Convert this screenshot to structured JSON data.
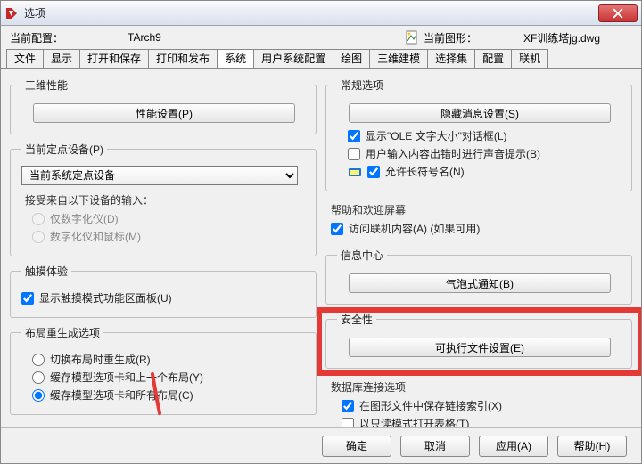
{
  "window": {
    "title": "选项"
  },
  "info": {
    "profile_label": "当前配置：",
    "profile_value": "TArch9",
    "drawing_label": "当前图形：",
    "drawing_value": "XF训练塔jg.dwg"
  },
  "tabs": [
    "文件",
    "显示",
    "打开和保存",
    "打印和发布",
    "系统",
    "用户系统配置",
    "绘图",
    "三维建模",
    "选择集",
    "配置",
    "联机"
  ],
  "active_tab_index": 4,
  "left": {
    "perf3d": {
      "legend": "三维性能",
      "btn": "性能设置(P)"
    },
    "pointing": {
      "legend": "当前定点设备(P)",
      "selected": "当前系统定点设备",
      "sub_label": "接受来自以下设备的输入：",
      "opt1": "仅数字化仪(D)",
      "opt2": "数字化仪和鼠标(M)"
    },
    "touch": {
      "legend": "触摸体验",
      "chk": "显示触摸模式功能区面板(U)"
    },
    "regen": {
      "legend": "布局重生成选项",
      "opt1": "切换布局时重生成(R)",
      "opt2": "缓存模型选项卡和上一个布局(Y)",
      "opt3": "缓存模型选项卡和所有布局(C)"
    }
  },
  "right": {
    "general": {
      "legend": "常规选项",
      "btn": "隐藏消息设置(S)",
      "c1": "显示\"OLE 文字大小\"对话框(L)",
      "c2": "用户输入内容出错时进行声音提示(B)",
      "c3": "允许长符号名(N)"
    },
    "help": {
      "legend": "帮助和欢迎屏幕",
      "c1": "访问联机内容(A) (如果可用)"
    },
    "infoc": {
      "legend": "信息中心",
      "btn": "气泡式通知(B)"
    },
    "security": {
      "legend": "安全性",
      "btn": "可执行文件设置(E)"
    },
    "dbconn": {
      "legend": "数据库连接选项",
      "c1": "在图形文件中保存链接索引(X)",
      "c2": "以只读模式打开表格(T)"
    }
  },
  "footer": {
    "ok": "确定",
    "cancel": "取消",
    "apply": "应用(A)",
    "help": "帮助(H)"
  }
}
